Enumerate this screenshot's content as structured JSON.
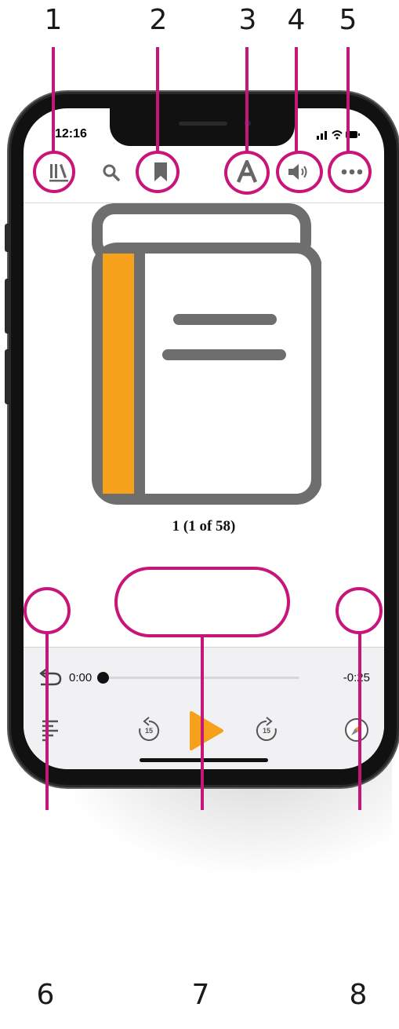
{
  "callouts": [
    "1",
    "2",
    "3",
    "4",
    "5",
    "6",
    "7",
    "8"
  ],
  "status_bar": {
    "time": "12:16"
  },
  "toolbar": {
    "icons": [
      "library-icon",
      "search-icon",
      "bookmark-icon",
      "text-settings-icon",
      "speaker-icon",
      "more-icon"
    ]
  },
  "book": {
    "page_label": "1 (1 of 58)",
    "spine_color": "#f5a11c",
    "outline_color": "#6e6e6e"
  },
  "player": {
    "elapsed": "0:00",
    "remaining": "-0:25",
    "progress": 0,
    "skip_back_label": "15",
    "skip_forward_label": "15",
    "play_color": "#f5a11c"
  },
  "annotation_color": "#c8157a"
}
